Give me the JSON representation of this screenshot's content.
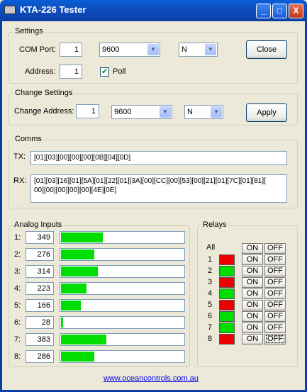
{
  "window": {
    "title": "KTA-226 Tester",
    "buttons": [
      "_",
      "□",
      "X"
    ]
  },
  "settings": {
    "label": "Settings",
    "com_port_label": "COM Port:",
    "com_port": "1",
    "baud": "9600",
    "parity": "N",
    "close_label": "Close",
    "address_label": "Address:",
    "address": "1",
    "poll_label": "Poll",
    "poll_checked": true
  },
  "change_settings": {
    "label": "Change Settings",
    "change_address_label": "Change Address:",
    "address": "1",
    "baud": "9600",
    "parity": "N",
    "apply_label": "Apply"
  },
  "comms": {
    "label": "Comms",
    "tx_label": "TX:",
    "tx": "[01][03][00][00][00][0B][04][0D]",
    "rx_label": "RX:",
    "rx_line1": "[01][03][16][01][5A][01][22][01][3A][00][CC][00][53][00][21][01][7C][01][81][",
    "rx_line2": "00][00][00][00][00][4E][0E]"
  },
  "analog": {
    "label": "Analog Inputs",
    "max": 1023,
    "inputs": [
      {
        "label": "1:",
        "value": "349",
        "fill": 0.34
      },
      {
        "label": "2:",
        "value": "276",
        "fill": 0.27
      },
      {
        "label": "3:",
        "value": "314",
        "fill": 0.3
      },
      {
        "label": "4:",
        "value": "223",
        "fill": 0.21
      },
      {
        "label": "5:",
        "value": "166",
        "fill": 0.16
      },
      {
        "label": "6:",
        "value": "28",
        "fill": 0.02
      },
      {
        "label": "7:",
        "value": "383",
        "fill": 0.37
      },
      {
        "label": "8:",
        "value": "286",
        "fill": 0.27
      }
    ]
  },
  "relays": {
    "label": "Relays",
    "all_label": "All",
    "on_label": "ON",
    "off_label": "OFF",
    "rows": [
      {
        "label": "1",
        "color": "#ee0000"
      },
      {
        "label": "2",
        "color": "#00dd00"
      },
      {
        "label": "3",
        "color": "#ee0000"
      },
      {
        "label": "4",
        "color": "#00dd00"
      },
      {
        "label": "5",
        "color": "#ee0000"
      },
      {
        "label": "6",
        "color": "#00dd00"
      },
      {
        "label": "7",
        "color": "#00dd00"
      },
      {
        "label": "8",
        "color": "#ee0000"
      }
    ]
  },
  "footer": {
    "link": "www.oceancontrols.com.au"
  }
}
